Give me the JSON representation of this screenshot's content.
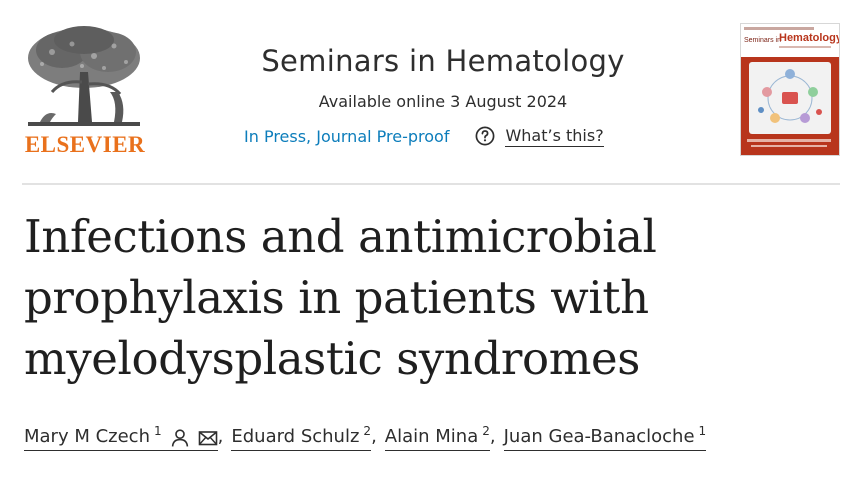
{
  "publisher": {
    "logo_label": "ELSEVIER",
    "logo_icon": "elsevier-tree-icon",
    "brand_color": "#e9711c"
  },
  "journal": {
    "title": "Seminars in Hematology",
    "available": "Available online 3 August 2024",
    "status_link": "In Press, Journal Pre-proof",
    "help_label": "What’s this?",
    "help_icon": "question-circle-icon",
    "link_color": "#0c7dbb",
    "cover": {
      "small_title": "Seminars in",
      "big_title": "Hematology",
      "cover_color": "#b8351c"
    }
  },
  "article": {
    "title_lines": [
      "Infections and antimicrobial",
      "prophylaxis in patients with",
      "myelodysplastic syndromes"
    ]
  },
  "authors": [
    {
      "name": "Mary M Czech",
      "affil": "1",
      "icons": [
        "person-icon",
        "envelope-icon"
      ]
    },
    {
      "name": "Eduard Schulz",
      "affil": "2"
    },
    {
      "name": "Alain Mina",
      "affil": "2"
    },
    {
      "name": "Juan Gea-Banacloche",
      "affil": "1"
    }
  ],
  "separator": ","
}
